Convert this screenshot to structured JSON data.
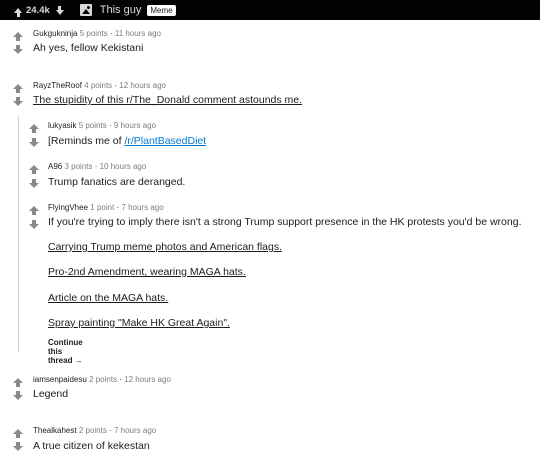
{
  "topbar": {
    "score": "24.4k",
    "title": "This guy",
    "flair": "Meme"
  },
  "comments": [
    {
      "author": "Gukgukninja",
      "points": "5 points",
      "time": "11 hours ago",
      "text": "Ah yes, fellow Kekistani"
    },
    {
      "author": "RayzTheRoof",
      "points": "4 points",
      "time": "12 hours ago",
      "text": "The stupidity of this r/The_Donald comment astounds me."
    },
    {
      "author": "lukyasik",
      "points": "5 points",
      "time": "9 hours ago",
      "text_prefix": "[Reminds me of ",
      "link": "/r/PlantBasedDiet"
    },
    {
      "author": "A96",
      "points": "3 points",
      "time": "10 hours ago",
      "text": "Trump fanatics are deranged."
    },
    {
      "author": "FlyingVhee",
      "points": "1 point",
      "time": "7 hours ago",
      "text": "If you're trying to imply there isn't a strong Trump support presence in the HK protests you'd be wrong.",
      "links": [
        "Carrying Trump meme photos and American flags.",
        "Pro-2nd Amendment, wearing MAGA hats.",
        "Article on the MAGA hats.",
        "Spray painting \"Make HK Great Again\"."
      ],
      "continue": "Continue this thread →"
    },
    {
      "author": "iamsenpaidesu",
      "points": "2 points",
      "time": "12 hours ago",
      "text": "Legend"
    },
    {
      "author": "Thealkahest",
      "points": "2 points",
      "time": "7 hours ago",
      "text": "A true citizen of kekestan"
    }
  ]
}
